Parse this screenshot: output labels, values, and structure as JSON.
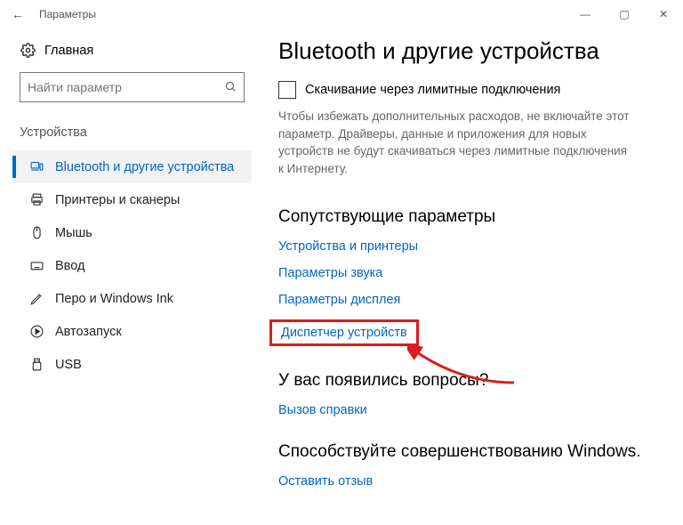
{
  "window": {
    "title": "Параметры"
  },
  "sidebar": {
    "home_label": "Главная",
    "search_placeholder": "Найти параметр",
    "section_label": "Устройства",
    "items": [
      {
        "label": "Bluetooth и другие устройства",
        "active": true
      },
      {
        "label": "Принтеры и сканеры"
      },
      {
        "label": "Мышь"
      },
      {
        "label": "Ввод"
      },
      {
        "label": "Перо и Windows Ink"
      },
      {
        "label": "Автозапуск"
      },
      {
        "label": "USB"
      }
    ]
  },
  "main": {
    "title": "Bluetooth и другие устройства",
    "metered_checkbox_label": "Скачивание через лимитные подключения",
    "metered_description": "Чтобы избежать дополнительных расходов, не включайте этот параметр. Драйверы, данные и приложения для новых устройств не будут скачиваться через лимитные подключения к Интернету.",
    "related": {
      "heading": "Сопутствующие параметры",
      "links": {
        "devices": "Устройства и принтеры",
        "sound": "Параметры звука",
        "display": "Параметры дисплея",
        "devmgr": "Диспетчер устройств"
      }
    },
    "questions": {
      "heading": "У вас появились вопросы?",
      "help_link": "Вызов справки"
    },
    "feedback": {
      "heading": "Способствуйте совершенствованию Windows.",
      "feedback_link": "Оставить отзыв"
    }
  }
}
